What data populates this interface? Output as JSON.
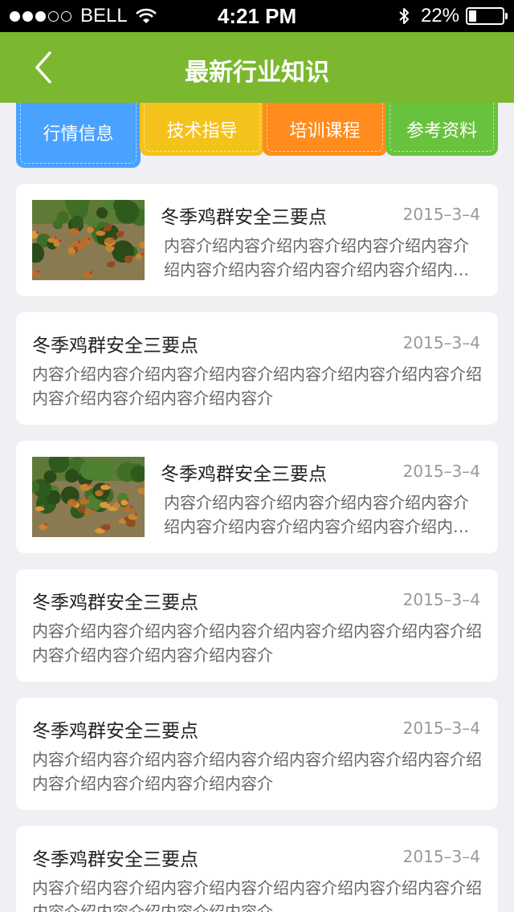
{
  "status_bar": {
    "signal_icon": "signal-dots-icon",
    "carrier": "BELL",
    "time": "4:21 PM",
    "battery_percent": "22%",
    "battery_level": 0.22
  },
  "nav": {
    "title": "最新行业知识",
    "back_icon": "chevron-left-icon"
  },
  "categories": [
    {
      "label": "行情信息",
      "color": "#4aa2ff",
      "selected": true
    },
    {
      "label": "技术指导",
      "color": "#f4c31b"
    },
    {
      "label": "培训课程",
      "color": "#ff8c1c"
    },
    {
      "label": "参考资料",
      "color": "#69c23d"
    }
  ],
  "articles": [
    {
      "title": "冬季鸡群安全三要点",
      "date": "2015–3–4",
      "has_image": true,
      "image": "chickens-in-garden-photo",
      "desc": "内容介绍内容介绍内容介绍内容介绍内容介绍内容介绍内容介绍内容介绍内容介绍内容介..."
    },
    {
      "title": "冬季鸡群安全三要点",
      "date": "2015–3–4",
      "has_image": false,
      "desc": "内容介绍内容介绍内容介绍内容介绍内容介绍内容介绍内容介绍内容介绍内容介绍内容介绍内容介"
    },
    {
      "title": "冬季鸡群安全三要点",
      "date": "2015–3–4",
      "has_image": true,
      "image": "chickens-in-garden-photo",
      "desc": "内容介绍内容介绍内容介绍内容介绍内容介绍内容介绍内容介绍内容介绍内容介绍内容介..."
    },
    {
      "title": "冬季鸡群安全三要点",
      "date": "2015–3–4",
      "has_image": false,
      "desc": "内容介绍内容介绍内容介绍内容介绍内容介绍内容介绍内容介绍内容介绍内容介绍内容介绍内容介"
    },
    {
      "title": "冬季鸡群安全三要点",
      "date": "2015–3–4",
      "has_image": false,
      "desc": "内容介绍内容介绍内容介绍内容介绍内容介绍内容介绍内容介绍内容介绍内容介绍内容介绍内容介"
    },
    {
      "title": "冬季鸡群安全三要点",
      "date": "2015–3–4",
      "has_image": false,
      "desc": "内容介绍内容介绍内容介绍内容介绍内容介绍内容介绍内容介绍内容介绍内容介绍内容介绍内容介"
    }
  ]
}
